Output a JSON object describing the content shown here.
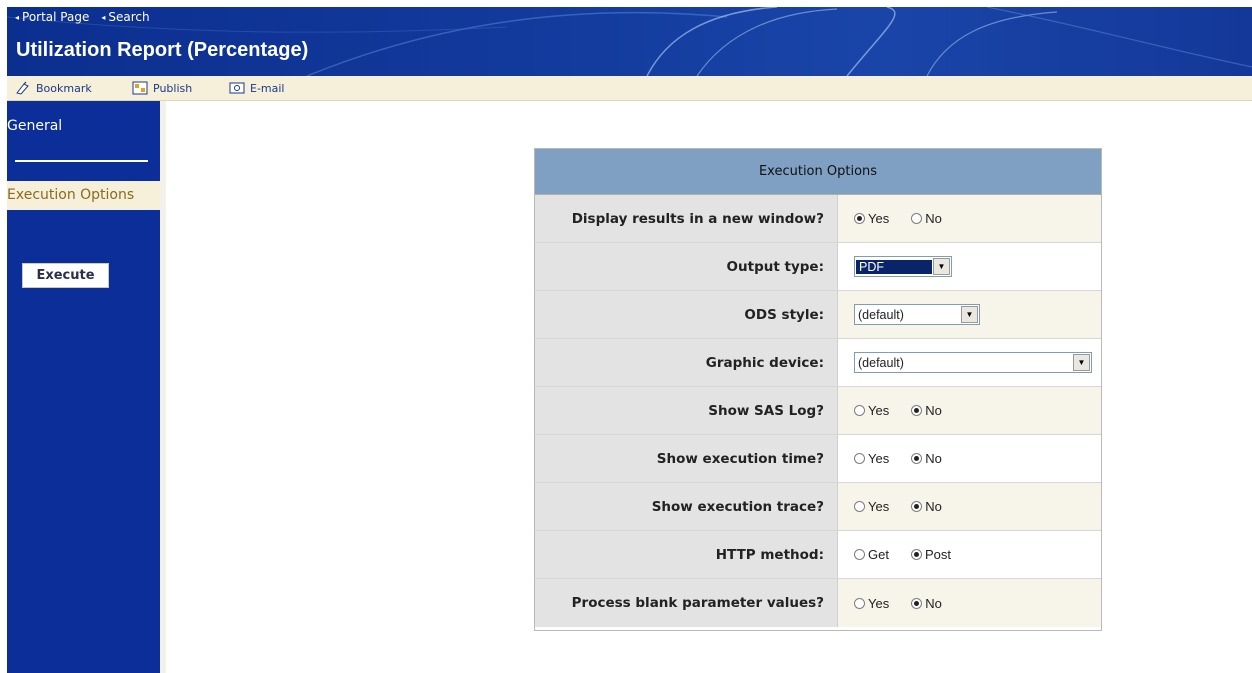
{
  "header": {
    "nav": [
      {
        "label": "Portal Page"
      },
      {
        "label": "Search"
      }
    ],
    "title": "Utilization Report (Percentage)"
  },
  "toolbar": {
    "bookmark_label": "Bookmark",
    "publish_label": "Publish",
    "email_label": "E-mail"
  },
  "sidebar": {
    "general_label": "General",
    "execution_options_label": "Execution Options",
    "execute_button": "Execute"
  },
  "panel": {
    "title": "Execution Options",
    "rows": [
      {
        "label": "Display results in a new window?",
        "type": "radio",
        "options": [
          "Yes",
          "No"
        ],
        "selected": "Yes"
      },
      {
        "label": "Output type:",
        "type": "select",
        "value": "PDF"
      },
      {
        "label": "ODS style:",
        "type": "select",
        "value": "(default)"
      },
      {
        "label": "Graphic device:",
        "type": "select",
        "value": "(default)"
      },
      {
        "label": "Show SAS Log?",
        "type": "radio",
        "options": [
          "Yes",
          "No"
        ],
        "selected": "No"
      },
      {
        "label": "Show execution time?",
        "type": "radio",
        "options": [
          "Yes",
          "No"
        ],
        "selected": "No"
      },
      {
        "label": "Show execution trace?",
        "type": "radio",
        "options": [
          "Yes",
          "No"
        ],
        "selected": "No"
      },
      {
        "label": "HTTP method:",
        "type": "radio",
        "options": [
          "Get",
          "Post"
        ],
        "selected": "Post"
      },
      {
        "label": "Process blank parameter values?",
        "type": "radio",
        "options": [
          "Yes",
          "No"
        ],
        "selected": "No"
      }
    ]
  },
  "colors": {
    "header_bg": "#12399c",
    "sidebar_bg": "#0b2e99",
    "toolbar_bg": "#f6efd9",
    "panel_header_bg": "#7f9fc3",
    "label_cell_bg": "#e3e3e3"
  }
}
